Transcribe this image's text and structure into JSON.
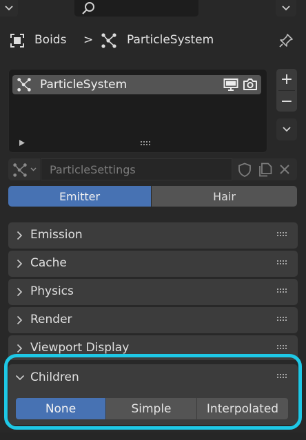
{
  "breadcrumb": {
    "object_name": "Boids",
    "separator": ">",
    "system_name": "ParticleSystem"
  },
  "list": {
    "items": [
      {
        "label": "ParticleSystem",
        "selected": true
      }
    ]
  },
  "side_buttons": {
    "add": "+",
    "remove": "−"
  },
  "settings": {
    "field_value": "ParticleSettings"
  },
  "type_toggle": {
    "options": [
      "Emitter",
      "Hair"
    ],
    "selected": "Emitter"
  },
  "panels": [
    {
      "label": "Emission",
      "expanded": false
    },
    {
      "label": "Cache",
      "expanded": false
    },
    {
      "label": "Physics",
      "expanded": false
    },
    {
      "label": "Render",
      "expanded": false
    },
    {
      "label": "Viewport Display",
      "expanded": false
    },
    {
      "label": "Children",
      "expanded": true
    }
  ],
  "children": {
    "options": [
      "None",
      "Simple",
      "Interpolated"
    ],
    "selected": "None"
  },
  "colors": {
    "accent": "#4772b3",
    "highlight": "#1ec8e6",
    "background": "#282828",
    "panel": "#3c3c3c"
  }
}
